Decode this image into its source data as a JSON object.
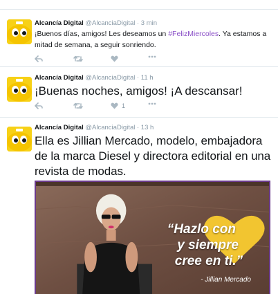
{
  "tweets": [
    {
      "name": "Alcancía Digital",
      "handle": "@AlcanciaDigital",
      "dot": "·",
      "time": "3 min",
      "text_before": "¡Buenos días, amigos! Les deseamos un ",
      "hashtag": "#FelizMiercoles",
      "text_after": ". Ya estamos a mitad de semana, a seguir sonriendo.",
      "like_count": ""
    },
    {
      "name": "Alcancía Digital",
      "handle": "@AlcanciaDigital",
      "dot": "·",
      "time": "11 h",
      "text": "¡Buenas noches, amigos! ¡A descansar!",
      "like_count": "1"
    },
    {
      "name": "Alcancía Digital",
      "handle": "@AlcanciaDigital",
      "dot": "·",
      "time": "13 h",
      "text": "Ella es Jillian Mercado, modelo, embajadora de la marca Diesel y directora editorial en una revista de modas.",
      "media": {
        "quote_line1": "“Hazlo con",
        "quote_line2": "y siempre",
        "quote_line3": "cree en ti.”",
        "author": "- Jillian Mercado"
      }
    }
  ],
  "colors": {
    "avatar_bg": "#f7d117",
    "hashtag": "#8a4fc7",
    "media_border": "#6b3a8c",
    "heart": "#f2c530",
    "icon": "#aab8c2"
  },
  "icons": [
    "reply-icon",
    "retweet-icon",
    "like-icon",
    "more-icon"
  ]
}
